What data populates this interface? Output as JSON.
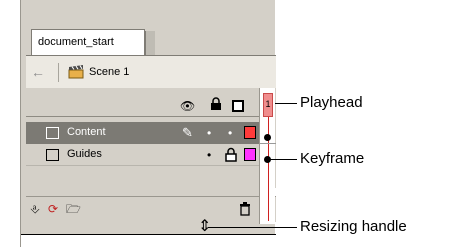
{
  "tab": {
    "label": "document_start"
  },
  "scene": {
    "label": "Scene 1"
  },
  "layers": [
    {
      "name": "Content",
      "selected": true,
      "color": "#ff3b3b"
    },
    {
      "name": "Guides",
      "selected": false,
      "color": "#ff33ff"
    }
  ],
  "timeline": {
    "playhead_frame": "1"
  },
  "callouts": {
    "playhead": "Playhead",
    "keyframe": "Keyframe",
    "resize": "Resizing handle"
  }
}
